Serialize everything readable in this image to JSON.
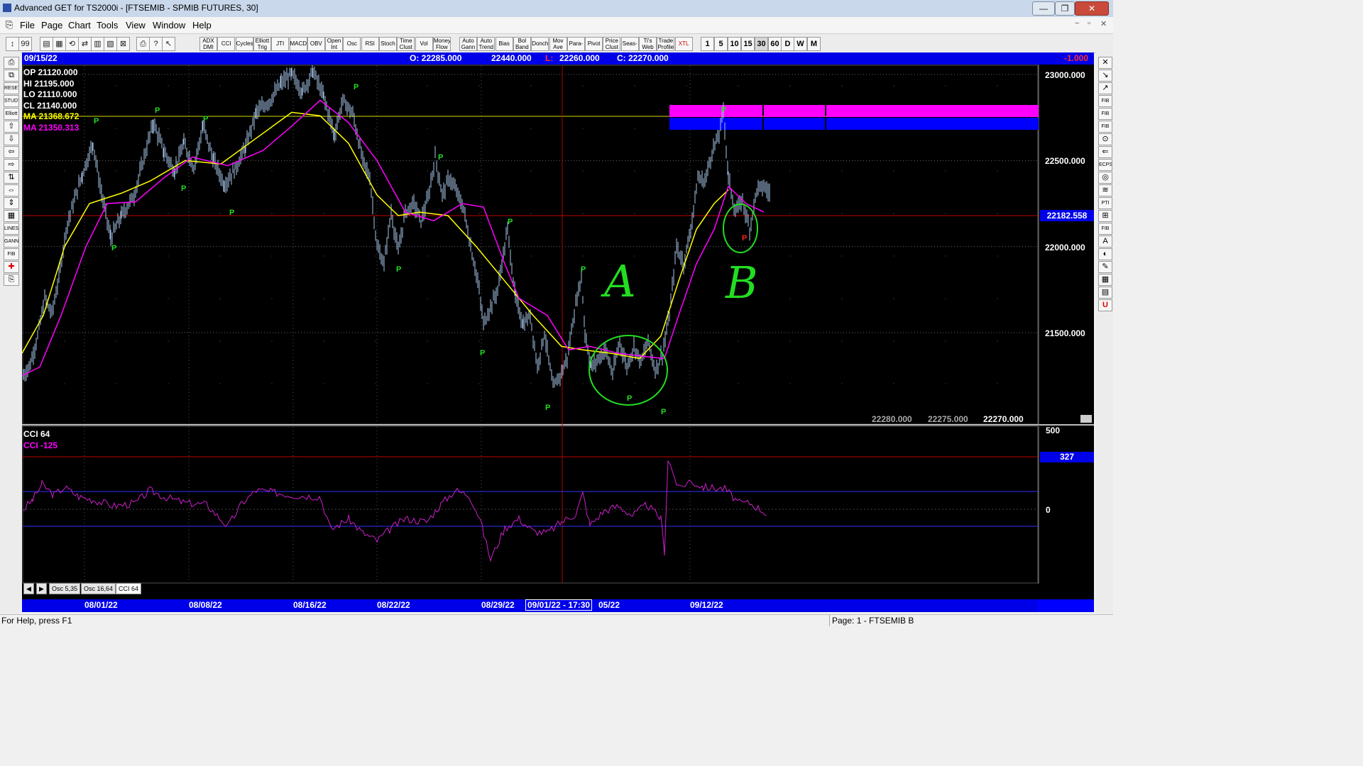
{
  "window": {
    "title": "Advanced GET for TS2000i - [FTSEMIB - SPMIB FUTURES, 30]",
    "minimize": "—",
    "restore": "❐",
    "close": "✕"
  },
  "menu": [
    {
      "label": "File"
    },
    {
      "label": "Page"
    },
    {
      "label": "Chart"
    },
    {
      "label": "Tools"
    },
    {
      "label": "View"
    },
    {
      "label": "Window"
    },
    {
      "label": "Help"
    }
  ],
  "toolbar": {
    "indicators": [
      "ADX DMI",
      "CCI",
      "Cycles",
      "Elliott Trig",
      "JTI",
      "MACD",
      "OBV",
      "Open Int",
      "Osc",
      "RSI",
      "Stoch",
      "Time Clust",
      "Vol",
      "Money Flow"
    ],
    "studies": [
      "Auto Gann",
      "Auto Trend",
      "Bias",
      "Bol Band",
      "Donch",
      "Mov Ave",
      "Para-bolic",
      "Pivot",
      "Price Clust",
      "Seas-onals",
      "Ti's Web",
      "Trade Profile",
      "XTL"
    ],
    "periods": [
      "1",
      "5",
      "10",
      "15",
      "30",
      "60",
      "D",
      "W",
      "M"
    ]
  },
  "left_tools": [
    "RESET",
    "STUDY",
    "Elliott",
    "LINES",
    "GANN",
    "FIB"
  ],
  "right_tools": [
    "FIB RET",
    "FIB EXT",
    "FIB TIME",
    "ECPS",
    "PTI",
    "FIB",
    "A"
  ],
  "infobar": {
    "date": "09/15/22",
    "open": "O: 22285.000",
    "high": "22440.000",
    "low": "L:",
    "low_value": "22260.000",
    "close": "C: 22270.000",
    "change": "-1.000"
  },
  "legend": {
    "op": "OP  21120.000",
    "hi": "HI   21195.000",
    "lo": "LO  21110.000",
    "cl": "CL  21140.000",
    "ma1": "MA  21368.672",
    "ma2": "MA  21350.313"
  },
  "price_axis": {
    "labels": [
      "23000.000",
      "22500.000",
      "22000.000",
      "21500.000"
    ],
    "current": "22182.558"
  },
  "bottom_values": [
    "22280.000",
    "22275.000",
    "22270.000"
  ],
  "cci": {
    "title": "CCI 64",
    "value": "CCI  -125",
    "axis": [
      "500",
      "0"
    ],
    "current": "327"
  },
  "annotations": {
    "a": "A",
    "b": "B"
  },
  "pivot_label": "P",
  "dates": {
    "d1": "08/01/22",
    "d2": "08/08/22",
    "d3": "08/16/22",
    "d4": "08/22/22",
    "d5": "08/29/22",
    "cursor": "09/01/22 - 17:30",
    "d6": "05/22",
    "d7": "09/12/22"
  },
  "tabs": [
    "Osc 5,35",
    "Osc 16,64",
    "CCI 64"
  ],
  "status": {
    "help": "For Help, press F1",
    "page": "Page: 1 - FTSEMIB B"
  },
  "colors": {
    "background": "#000000",
    "price": "#a9c8ec",
    "ma_fast": "#ffff00",
    "ma_slow": "#ff00ff",
    "pivot": "#22dd22",
    "infobar": "#0000e8"
  }
}
